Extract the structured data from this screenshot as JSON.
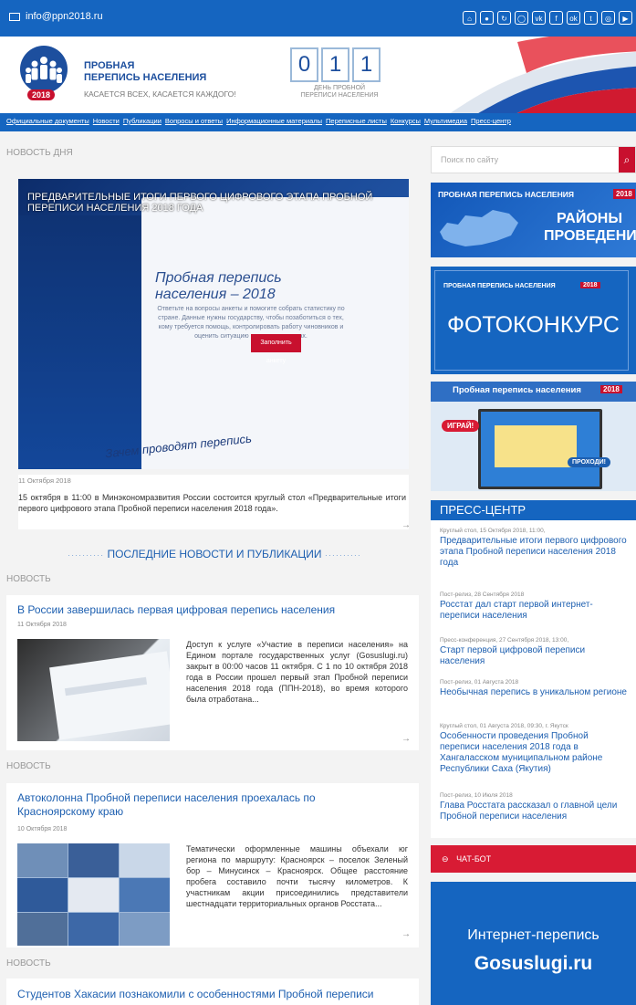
{
  "topbar": {
    "email": "info@ppn2018.ru",
    "socials": [
      "home-icon",
      "person-icon",
      "refresh-icon",
      "chat-icon",
      "vk-icon",
      "facebook-icon",
      "odnoklassniki-icon",
      "twitter-icon",
      "instagram-icon",
      "youtube-icon"
    ]
  },
  "header": {
    "logo_line1": "ПРОБНАЯ",
    "logo_line2": "ПЕРЕПИСЬ НАСЕЛЕНИЯ",
    "logo_tagline": "КАСАЕТСЯ ВСЕХ, КАСАЕТСЯ КАЖДОГО!",
    "logo_year": "2018",
    "counter": [
      "0",
      "1",
      "1"
    ],
    "counter_caption1": "ДЕНЬ ПРОБНОЙ",
    "counter_caption2": "ПЕРЕПИСИ НАСЕЛЕНИЯ"
  },
  "nav": [
    "Официальные документы",
    "Новости",
    "Публикации",
    "Вопросы и ответы",
    "Информационные материалы",
    "Переписные листы",
    "Конкурсы",
    "Мультимедиа",
    "Пресс-центр"
  ],
  "news_of_day": {
    "label": "НОВОСТЬ ДНЯ",
    "hero_title": "ПРЕДВАРИТЕЛЬНЫЕ ИТОГИ ПЕРВОГО ЦИФРОВОГО ЭТАПА ПРОБНОЙ ПЕРЕПИСИ НАСЕЛЕНИЯ 2018 ГОДА",
    "hero_slide_heading": "Пробная перепись населения – 2018",
    "hero_slide_text": "Ответьте на вопросы анкеты и помогите собрать статистику по стране. Данные нужны государству, чтобы позаботиться о тех, кому требуется помощь, контролировать работу чиновников и оценить ситуацию в разных регионах.",
    "hero_slide_button": "Заполнить анкету",
    "hero_slide_footer": "Зачем проводят перепись",
    "date": "11 Октября 2018",
    "text": "15 октября в 11:00 в Минэкономразвития России состоится круглый стол «Предварительные итоги первого цифрового этапа Пробной переписи населения 2018 года»."
  },
  "latest": {
    "heading": "ПОСЛЕДНИЕ НОВОСТИ И ПУБЛИКАЦИИ",
    "items": [
      {
        "label": "НОВОСТЬ",
        "title": "В России завершилась первая цифровая перепись населения",
        "date": "11 Октября 2018",
        "text": "Доступ к услуге «Участие в переписи населения» на Едином портале государственных услуг (Gosuslugi.ru) закрыт в 00:00 часов 11 октября. С 1 по 10 октября 2018 года в России прошел первый этап Пробной переписи населения 2018 года (ППН-2018), во время которого была отработана..."
      },
      {
        "label": "НОВОСТЬ",
        "title": "Автоколонна Пробной переписи населения проехалась по Красноярскому краю",
        "date": "10 Октября 2018",
        "text": "Тематически оформленные машины объехали юг региона по маршруту: Красноярск – поселок Зеленый бор – Минусинск – Красноярск. Общее расстояние пробега составило почти тысячу километров. К участникам акции присоединились представители шестнадцати территориальных органов Росстата..."
      },
      {
        "label": "НОВОСТЬ",
        "title": "Студентов Хакасии познакомили с особенностями Пробной переписи"
      }
    ]
  },
  "sidebar": {
    "search_placeholder": "Поиск по сайту",
    "banner1_top": "ПРОБНАЯ ПЕРЕПИСЬ НАСЕЛЕНИЯ",
    "banner1_year": "2018",
    "banner1_line1": "РАЙОНЫ",
    "banner1_line2": "ПРОВЕДЕНИЯ",
    "banner2_top": "ПРОБНАЯ ПЕРЕПИСЬ НАСЕЛЕНИЯ",
    "banner2_year": "2018",
    "banner2_main": "ФОТОКОНКУРС",
    "banner3_top": "Пробная перепись населения",
    "banner3_year": "2018",
    "banner3_play": "ИГРАЙ!",
    "banner3_go": "ПРОХОДИ!",
    "press_heading": "ПРЕСС-ЦЕНТР",
    "press": [
      {
        "meta": "Круглый стол, 15 Октября 2018, 11:00,",
        "title": "Предварительные итоги первого цифрового этапа Пробной переписи населения 2018 года"
      },
      {
        "meta": "Пост-релиз, 28 Сентября 2018",
        "title": "Росстат дал старт первой интернет-переписи населения"
      },
      {
        "meta": "Пресс-конференция, 27 Сентября 2018, 13:00,",
        "title": "Старт первой цифровой переписи населения"
      },
      {
        "meta": "Пост-релиз, 01 Августа 2018",
        "title": "Необычная перепись в уникальном регионе"
      },
      {
        "meta": "Круглый стол, 01 Августа 2018, 09:30, г. Якутск",
        "title": "Особенности проведения Пробной переписи населения 2018 года в Хангаласском муниципальном районе Республики Саха (Якутия)"
      },
      {
        "meta": "Пост-релиз, 10 Июля 2018",
        "title": "Глава Росстата рассказал о главной цели Пробной переписи населения"
      }
    ],
    "chat_label": "ЧАТ-БОТ",
    "gos_line1": "Интернет-перепись",
    "gos_line2": "Gosuslugi.ru"
  }
}
